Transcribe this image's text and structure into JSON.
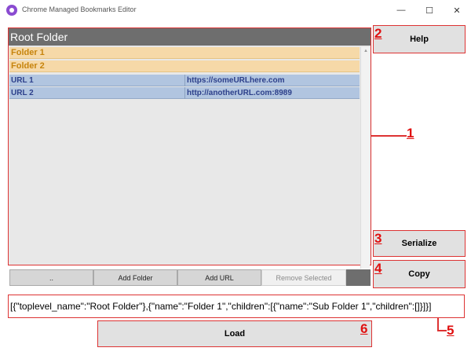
{
  "window": {
    "title": "Chrome Managed Bookmarks Editor",
    "minimize_glyph": "—",
    "maximize_glyph": "☐",
    "close_glyph": "✕"
  },
  "tree": {
    "root_label": "Root Folder",
    "folders": [
      "Folder 1",
      "Folder 2"
    ],
    "urls": [
      {
        "name": "URL 1",
        "url": "https://someURLhere.com"
      },
      {
        "name": "URL 2",
        "url": "http://anotherURL.com:8989"
      }
    ],
    "scroll_up_glyph": "▲",
    "scroll_down_glyph": "▼"
  },
  "toolbar": {
    "up_label": "..",
    "add_folder_label": "Add Folder",
    "add_url_label": "Add URL",
    "remove_label": "Remove Selected"
  },
  "buttons": {
    "help": "Help",
    "serialize": "Serialize",
    "copy": "Copy",
    "load": "Load"
  },
  "serialized_text": "[{\"toplevel_name\":\"Root Folder\"},{\"name\":\"Folder 1\",\"children\":[{\"name\":\"Sub Folder 1\",\"children\":[]}]}]",
  "annotations": [
    "1",
    "2",
    "3",
    "4",
    "5",
    "6"
  ],
  "colors": {
    "annotation_red": "#e01010",
    "root_header": "#6e6e6e",
    "folder_row": "#f6d9a8",
    "folder_text": "#c7840d",
    "url_row": "#b1c5e0",
    "url_text": "#2c3f8a"
  }
}
